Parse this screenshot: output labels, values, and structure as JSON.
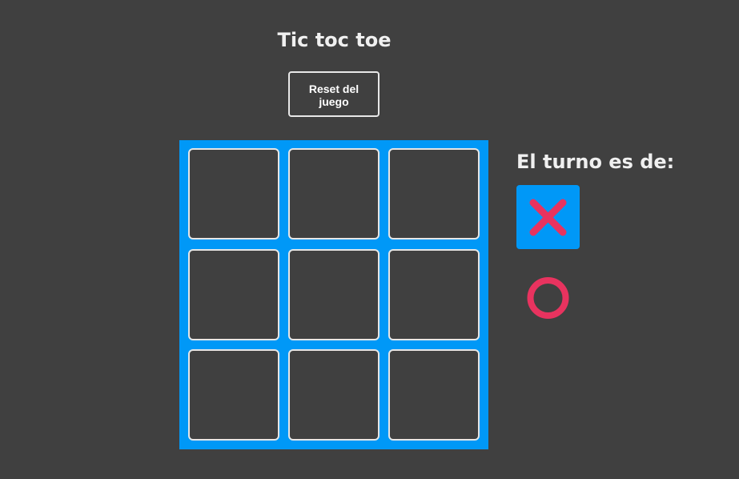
{
  "game": {
    "title": "Tic toc toe",
    "reset_label": "Reset del juego"
  },
  "board": {
    "cells": [
      "",
      "",
      "",
      "",
      "",
      "",
      "",
      "",
      ""
    ]
  },
  "turn": {
    "label": "El turno es de:",
    "active_player": "X",
    "players": [
      {
        "symbol": "x-icon",
        "active": true
      },
      {
        "symbol": "o-icon",
        "active": false
      }
    ]
  },
  "colors": {
    "background": "#404040",
    "board_frame": "#0098f7",
    "active_highlight": "#0098f7",
    "mark": "#e8335f",
    "cell_border": "#e6e6e6"
  }
}
